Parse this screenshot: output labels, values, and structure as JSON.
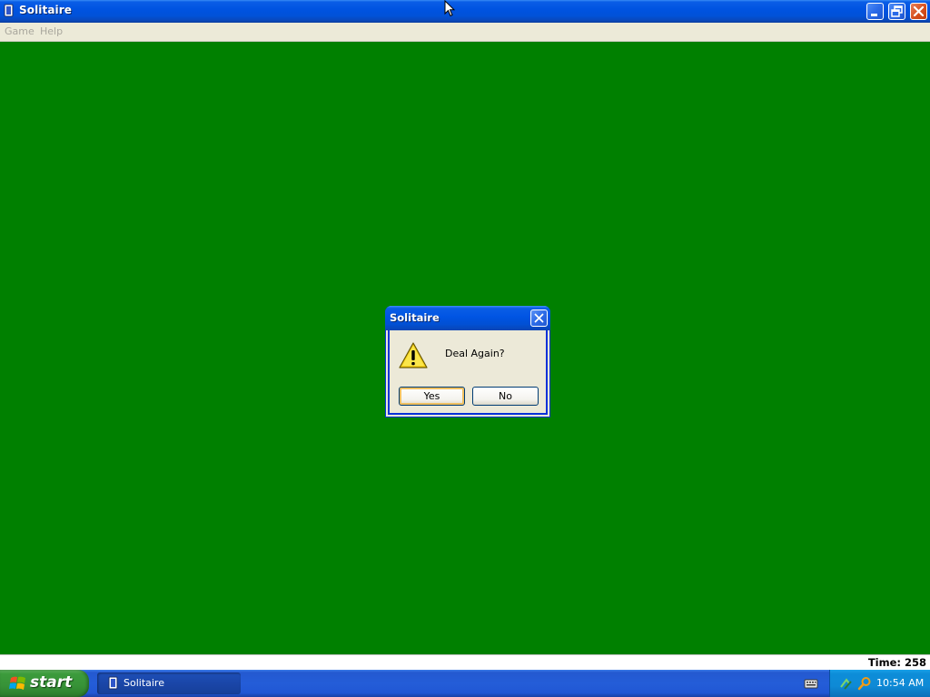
{
  "window": {
    "title": "Solitaire",
    "icon": "solitaire-card-icon"
  },
  "menubar": {
    "items": [
      {
        "label": "Game"
      },
      {
        "label": "Help"
      }
    ]
  },
  "statusbar": {
    "time_text": "Time: 258"
  },
  "dialog": {
    "title": "Solitaire",
    "message": "Deal Again?",
    "icon": "warning-icon",
    "yes_label": "Yes",
    "no_label": "No"
  },
  "taskbar": {
    "start_label": "start",
    "task_label": "Solitaire",
    "clock": "10:54 AM"
  },
  "colors": {
    "felt": "#008000",
    "titlebar_blue": "#0054e3",
    "taskbar_blue": "#245dd8",
    "start_green": "#379237"
  }
}
